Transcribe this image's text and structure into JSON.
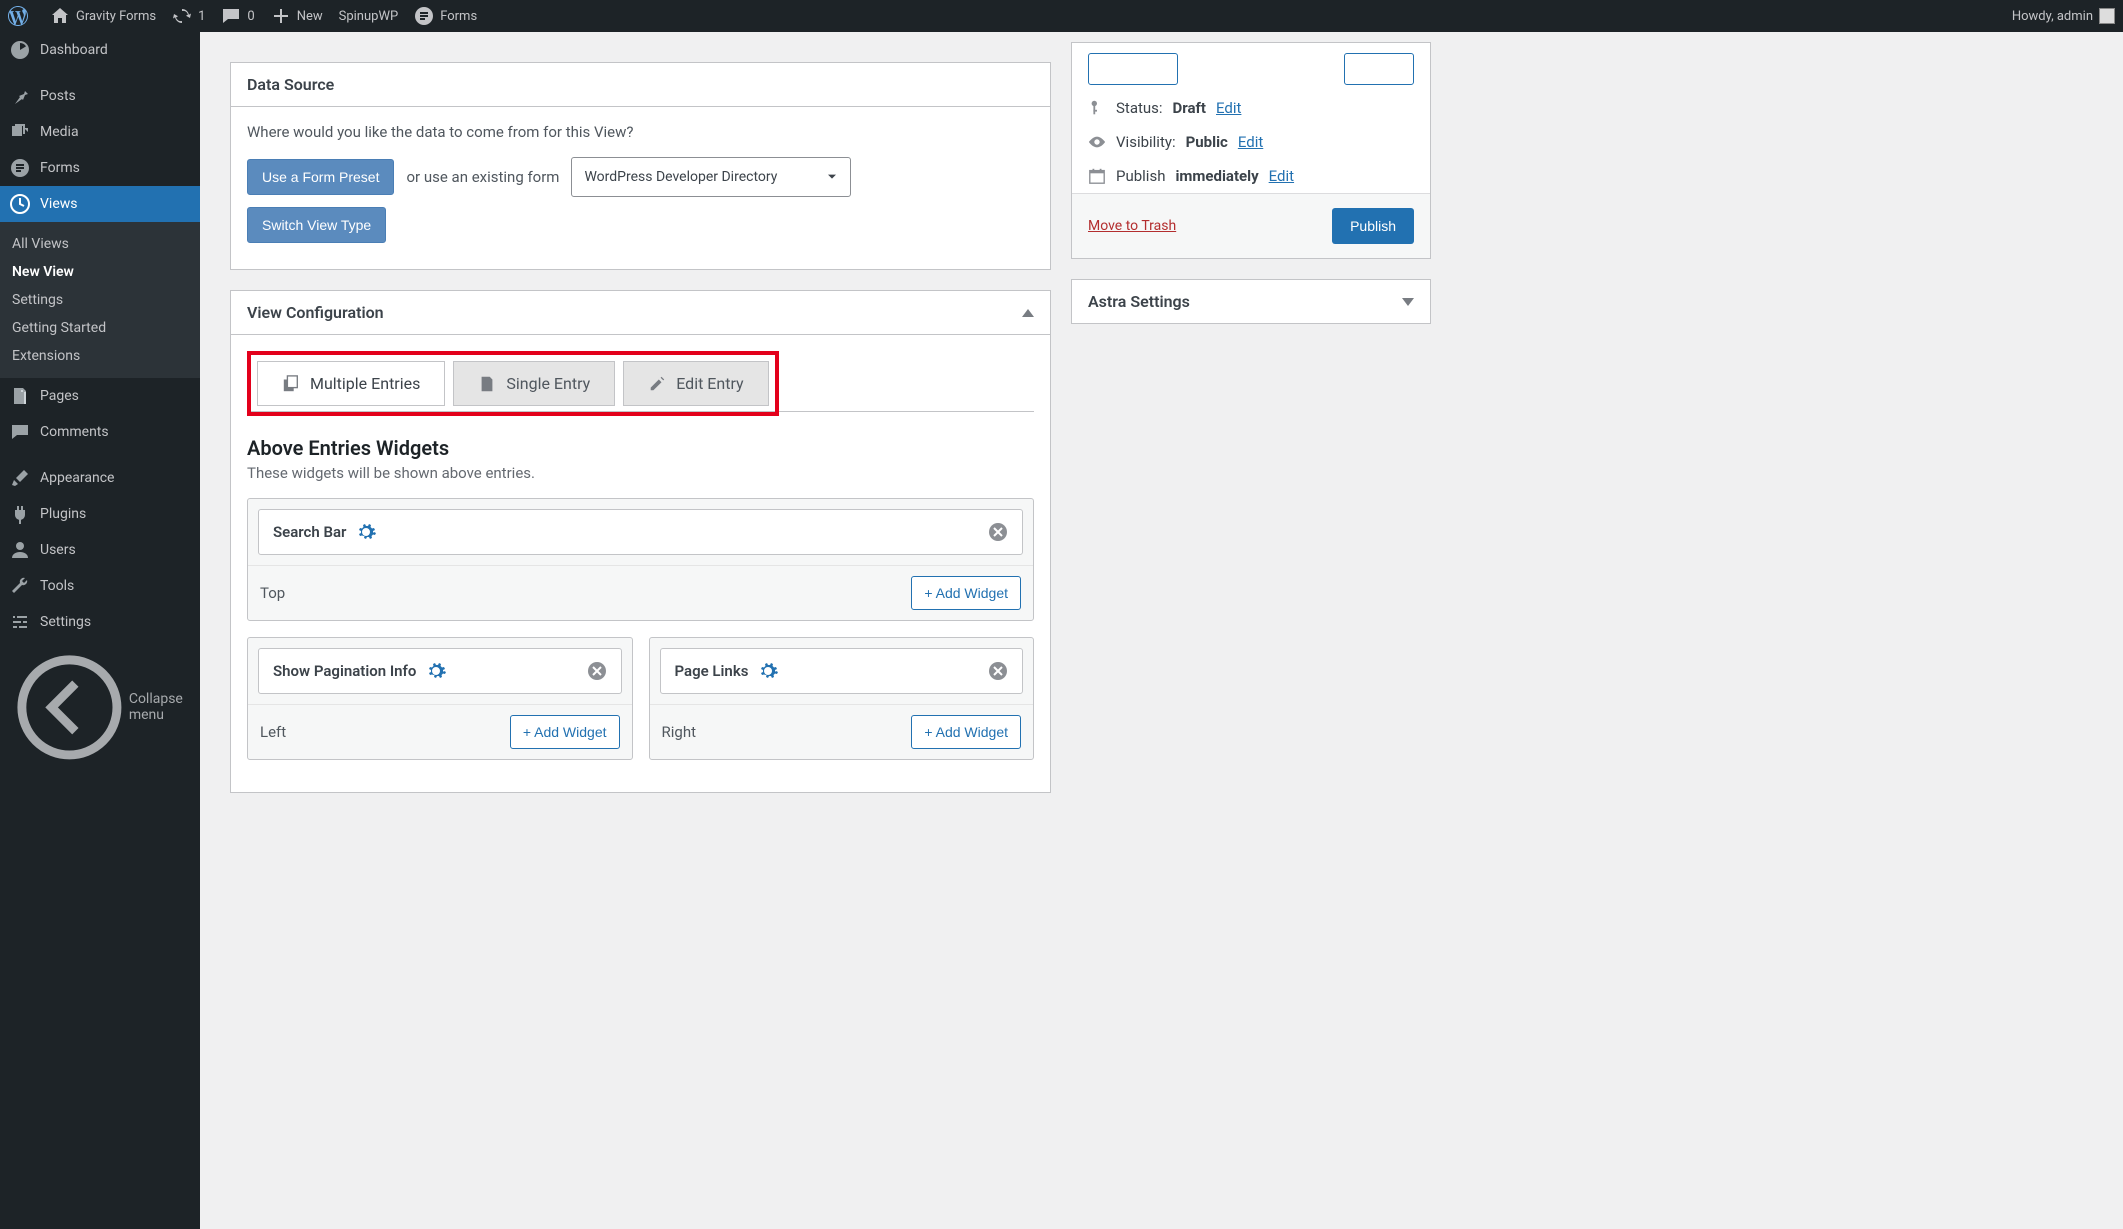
{
  "adminbar": {
    "site_title": "Gravity Forms",
    "updates_count": "1",
    "comments_count": "0",
    "new_label": "New",
    "spinupwp": "SpinupWP",
    "forms": "Forms",
    "howdy": "Howdy, admin"
  },
  "sidebar": {
    "items": [
      {
        "label": "Dashboard",
        "icon": "dashboard"
      },
      {
        "label": "Posts",
        "icon": "pin"
      },
      {
        "label": "Media",
        "icon": "media"
      },
      {
        "label": "Forms",
        "icon": "forms"
      },
      {
        "label": "Views",
        "icon": "views"
      },
      {
        "label": "Pages",
        "icon": "pages"
      },
      {
        "label": "Comments",
        "icon": "comments"
      },
      {
        "label": "Appearance",
        "icon": "appearance"
      },
      {
        "label": "Plugins",
        "icon": "plugins"
      },
      {
        "label": "Users",
        "icon": "users"
      },
      {
        "label": "Tools",
        "icon": "tools"
      },
      {
        "label": "Settings",
        "icon": "settings"
      }
    ],
    "submenu": [
      "All Views",
      "New View",
      "Settings",
      "Getting Started",
      "Extensions"
    ],
    "collapse": "Collapse menu"
  },
  "datasource": {
    "title": "Data Source",
    "prompt": "Where would you like the data to come from for this View?",
    "preset_btn": "Use a Form Preset",
    "or_text": "or use an existing form",
    "selected_form": "WordPress Developer Directory",
    "switch_btn": "Switch View Type"
  },
  "viewconfig": {
    "title": "View Configuration",
    "tabs": [
      {
        "label": "Multiple Entries"
      },
      {
        "label": "Single Entry"
      },
      {
        "label": "Edit Entry"
      }
    ],
    "above_title": "Above Entries Widgets",
    "above_sub": "These widgets will be shown above entries.",
    "widgets": {
      "top": {
        "label": "Top",
        "items": [
          "Search Bar"
        ],
        "add": "+ Add Widget"
      },
      "left": {
        "label": "Left",
        "items": [
          "Show Pagination Info"
        ],
        "add": "+ Add Widget"
      },
      "right": {
        "label": "Right",
        "items": [
          "Page Links"
        ],
        "add": "+ Add Widget"
      }
    }
  },
  "publish": {
    "status_label": "Status:",
    "status_value": "Draft",
    "visibility_label": "Visibility:",
    "visibility_value": "Public",
    "publish_label": "Publish",
    "publish_value": "immediately",
    "edit": "Edit",
    "trash": "Move to Trash",
    "publish_btn": "Publish"
  },
  "astra": {
    "title": "Astra Settings"
  }
}
